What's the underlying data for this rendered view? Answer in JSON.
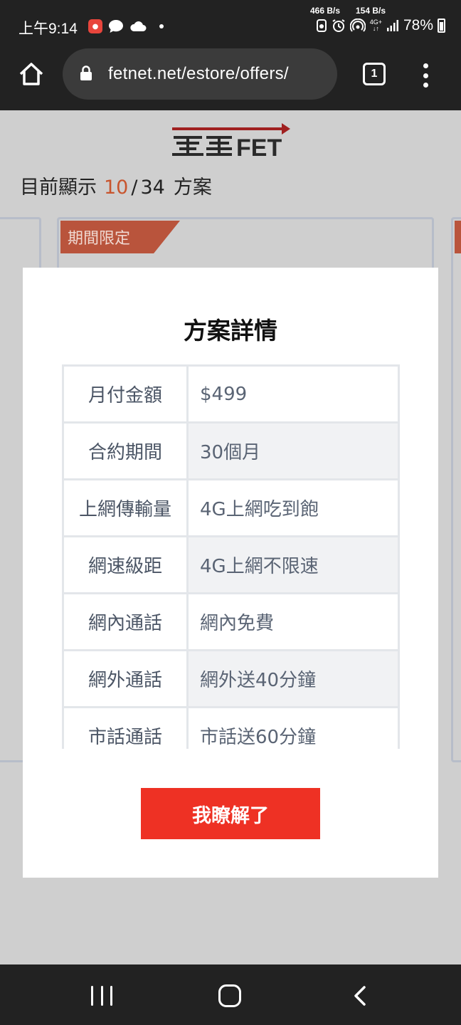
{
  "status_bar": {
    "time": "上午9:14",
    "speed_down": "466 B/s",
    "speed_up": "154 B/s",
    "network": "4G+",
    "battery": "78%"
  },
  "browser": {
    "url": "fetnet.net/estore/offers/",
    "tab_count": "1"
  },
  "page": {
    "brand_text": "FET",
    "count_prefix": "目前顯示",
    "count_current": "10",
    "count_separator": "/",
    "count_total": "34",
    "count_suffix": "方案",
    "ribbon_label": "期間限定"
  },
  "modal": {
    "title": "方案詳情",
    "rows": [
      {
        "label": "月付金額",
        "value": "$499"
      },
      {
        "label": "合約期間",
        "value": "30個月"
      },
      {
        "label": "上網傳輸量",
        "value": "4G上網吃到飽"
      },
      {
        "label": "網速級距",
        "value": "4G上網不限速"
      },
      {
        "label": "網內通話",
        "value": "網內免費"
      },
      {
        "label": "網外通話",
        "value": "網外送40分鐘"
      },
      {
        "label": "市話通話",
        "value": "市話送60分鐘"
      }
    ],
    "confirm_label": "我瞭解了"
  },
  "colors": {
    "accent_red": "#ee3124",
    "count_highlight": "#c8552e",
    "ribbon": "#b9543c",
    "system_bar": "#222222"
  }
}
